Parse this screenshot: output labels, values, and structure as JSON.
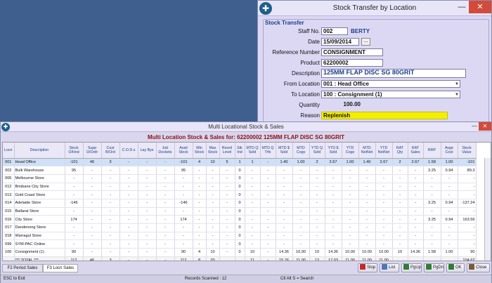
{
  "transfer": {
    "window_title": "Stock Transfer by Location",
    "min_glyph": "—",
    "close_glyph": "✕",
    "group_title": "Stock Transfer",
    "fields": {
      "staff_label": "Staff No.",
      "staff_value": "002",
      "staff_name": "BERTY",
      "date_label": "Date",
      "date_value": "15/09/2014",
      "date_button": "...",
      "ref_label": "Reference Number",
      "ref_value": "CONSIGNMENT",
      "product_label": "Product",
      "product_value": "62200002",
      "desc_label": "Description",
      "desc_value": "125MM FLAP DISC SG 80GRIT",
      "from_label": "From Location",
      "from_value": "001 : Head Office",
      "to_label": "To Location",
      "to_value": "100 : Consignment (1)",
      "qty_label": "Quantity",
      "qty_value": "100.00",
      "reason_label": "Reason",
      "reason_value": "Replenish"
    }
  },
  "multi": {
    "window_title": "Multi Locational Stock & Sales",
    "heading": "Multi Location Stock & Sales  for: 62200002 125MM FLAP DISC SG 80GRIT",
    "columns": [
      "Locn",
      "Description",
      "Stock O/Hnd",
      "Supp O/Ordr",
      "Cust B/Ord",
      "C.O.D.s",
      "Lay Bys",
      "Job Dockets",
      "Avail Stock",
      "Min Stock",
      "Max Stock",
      "Reord Level",
      "Stk Ind",
      "MTD Q Sold",
      "MTD Q Trfs",
      "MTD $ Sold",
      "MTD Cogs",
      "YTD Q Sold",
      "YTD $ Sold",
      "YTD Cogs",
      "MTD NetNet",
      "YTD NetNet",
      "RAT Qty",
      "RAT Sales",
      "RRP",
      "Avge Cost",
      "Stock Value"
    ],
    "rows": [
      [
        "001",
        "Head Office",
        "-101",
        "46",
        "3",
        "-",
        "-",
        "-",
        "-101",
        "4",
        "10",
        "5",
        "1",
        "1",
        "-",
        "1.40",
        "1.00",
        "2",
        "2.67",
        "1.00",
        "1.40",
        "2.67",
        "2",
        "2.67",
        "1.58",
        "1.00",
        "-101"
      ],
      [
        "002",
        "Bulk Warehouse",
        "95",
        "-",
        "-",
        "-",
        "-",
        "-",
        "95",
        "-",
        "-",
        "-",
        "0",
        "-",
        "-",
        "-",
        "-",
        "-",
        "-",
        "-",
        "-",
        "-",
        "-",
        "-",
        "3.25",
        "0.94",
        "89.3"
      ],
      [
        "006",
        "Melbourne Store",
        "-",
        "-",
        "-",
        "-",
        "-",
        "-",
        "-",
        "-",
        "-",
        "-",
        "0",
        "-",
        "-",
        "-",
        "-",
        "-",
        "-",
        "-",
        "-",
        "-",
        "-",
        "-",
        "-",
        "-",
        "-"
      ],
      [
        "012",
        "Brisbane City Store",
        "-",
        "-",
        "-",
        "-",
        "-",
        "-",
        "-",
        "-",
        "-",
        "-",
        "0",
        "-",
        "-",
        "-",
        "-",
        "-",
        "-",
        "-",
        "-",
        "-",
        "-",
        "-",
        "-",
        "-",
        "-"
      ],
      [
        "013",
        "Gold Coast Store",
        "-",
        "-",
        "-",
        "-",
        "-",
        "-",
        "-",
        "-",
        "-",
        "-",
        "0",
        "-",
        "-",
        "-",
        "-",
        "-",
        "-",
        "-",
        "-",
        "-",
        "-",
        "-",
        "-",
        "-",
        "-"
      ],
      [
        "014",
        "Adelaide Store",
        "-146",
        "-",
        "-",
        "-",
        "-",
        "-",
        "-146",
        "-",
        "-",
        "-",
        "0",
        "-",
        "-",
        "-",
        "-",
        "-",
        "-",
        "-",
        "-",
        "-",
        "-",
        "-",
        "3.25",
        "0.94",
        "-137.24"
      ],
      [
        "015",
        "Ballarat Store",
        "-",
        "-",
        "-",
        "-",
        "-",
        "-",
        "-",
        "-",
        "-",
        "-",
        "0",
        "-",
        "-",
        "-",
        "-",
        "-",
        "-",
        "-",
        "-",
        "-",
        "-",
        "-",
        "-",
        "-",
        "-"
      ],
      [
        "016",
        "City Store",
        "174",
        "-",
        "-",
        "-",
        "-",
        "-",
        "174",
        "-",
        "-",
        "-",
        "0",
        "-",
        "-",
        "-",
        "-",
        "-",
        "-",
        "-",
        "-",
        "-",
        "-",
        "-",
        "3.25",
        "0.94",
        "163.56"
      ],
      [
        "017",
        "Dandenong Store",
        "-",
        "-",
        "-",
        "-",
        "-",
        "-",
        "-",
        "-",
        "-",
        "-",
        "0",
        "-",
        "-",
        "-",
        "-",
        "-",
        "-",
        "-",
        "-",
        "-",
        "-",
        "-",
        "-",
        "-",
        "-"
      ],
      [
        "018",
        "Warragul Store",
        "-",
        "-",
        "-",
        "-",
        "-",
        "-",
        "-",
        "-",
        "-",
        "-",
        "0",
        "-",
        "-",
        "-",
        "-",
        "-",
        "-",
        "-",
        "-",
        "-",
        "-",
        "-",
        "-",
        "-",
        "-"
      ],
      [
        "099",
        "SYM-PAC Online",
        "-",
        "-",
        "-",
        "-",
        "-",
        "-",
        "-",
        "-",
        "-",
        "-",
        "0",
        "-",
        "-",
        "-",
        "-",
        "-",
        "-",
        "-",
        "-",
        "-",
        "-",
        "-",
        "-",
        "-",
        "-"
      ],
      [
        "100",
        "Consignment (1)",
        "90",
        "-",
        "-",
        "-",
        "-",
        "-",
        "90",
        "4",
        "10",
        "-",
        "0",
        "10",
        "-",
        "14.36",
        "10.00",
        "10",
        "14.36",
        "10.00",
        "10.00",
        "10.00",
        "10",
        "14.36",
        "1.58",
        "1.00",
        "90"
      ],
      [
        "",
        "*** TOTAL ***",
        "112",
        "46",
        "3",
        "-",
        "-",
        "-",
        "112",
        "8",
        "20",
        "",
        "",
        "11",
        "-",
        "15.76",
        "11.00",
        "12",
        "17.03",
        "11.00",
        "11.00",
        "11.00",
        "",
        "",
        "",
        "",
        "104.62"
      ]
    ],
    "tabs": [
      "F2 Period Sales",
      "F3 Locn Sales"
    ],
    "buttons": {
      "stop": "Stop",
      "list": "List",
      "pgup": "PgUp",
      "pgdn": "PgDn",
      "ok": "OK",
      "close": "Close"
    },
    "status": {
      "left": "ESC to Exit",
      "middle": "Records Scanned : 12",
      "right": "Ctl Alt S = Search"
    }
  }
}
